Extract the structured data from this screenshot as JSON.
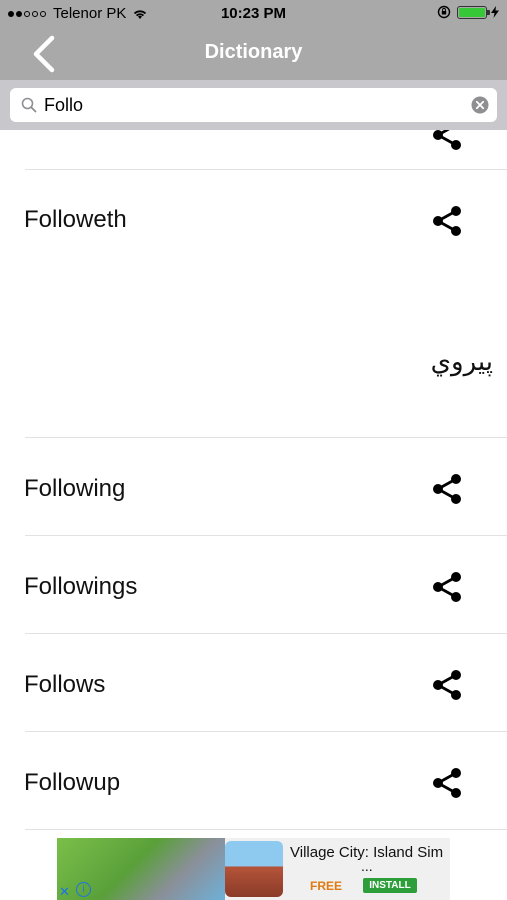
{
  "status_bar": {
    "carrier": "Telenor PK",
    "time": "10:23 PM"
  },
  "nav": {
    "title": "Dictionary"
  },
  "search": {
    "value": "Follo",
    "placeholder": ""
  },
  "results": [
    {
      "word": "Followeth",
      "meaning": "پيروي"
    },
    {
      "word": "Following"
    },
    {
      "word": "Followings"
    },
    {
      "word": "Follows"
    },
    {
      "word": "Followup"
    }
  ],
  "ad": {
    "title": "Village City: Island Sim",
    "ellipsis": "...",
    "free_label": "FREE",
    "install_label": "INSTALL",
    "close_glyph": "✕",
    "info_glyph": "i"
  },
  "colors": {
    "bar_background": "#a9a9a9",
    "search_background": "#c8c8cc",
    "battery": "#37c837"
  }
}
